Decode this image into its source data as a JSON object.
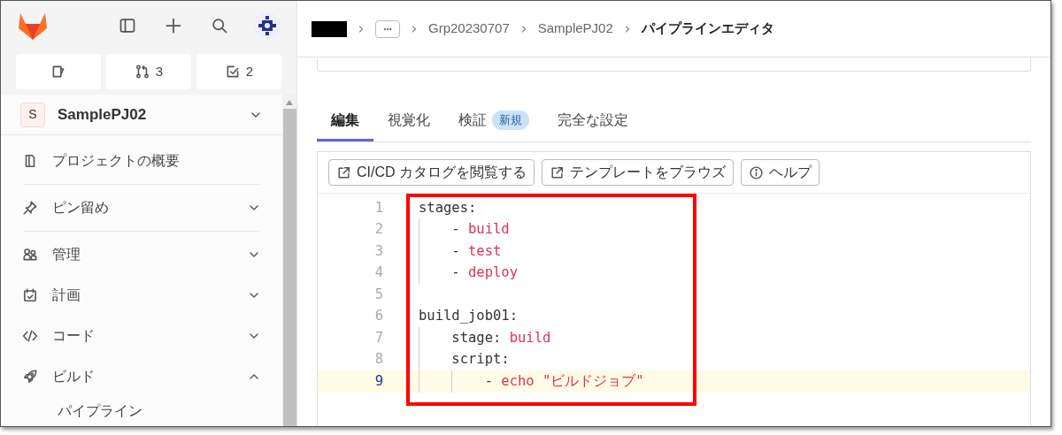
{
  "sidebar": {
    "counters": [
      {
        "kind": "issues"
      },
      {
        "kind": "merge",
        "count": "3"
      },
      {
        "kind": "todo",
        "count": "2"
      }
    ],
    "project": {
      "avatar": "S",
      "name": "SamplePJ02"
    },
    "items": [
      {
        "label": "プロジェクトの概要"
      },
      {
        "label": "ピン留め",
        "expanded": false
      },
      {
        "label": "管理",
        "expanded": false
      },
      {
        "label": "計画",
        "expanded": false
      },
      {
        "label": "コード",
        "expanded": false
      },
      {
        "label": "ビルド",
        "expanded": true,
        "children": [
          {
            "label": "パイプライン"
          }
        ]
      }
    ]
  },
  "breadcrumb": [
    {
      "kind": "redacted"
    },
    {
      "kind": "more"
    },
    {
      "kind": "link",
      "label": "Grp20230707"
    },
    {
      "kind": "link",
      "label": "SamplePJ02"
    },
    {
      "kind": "current",
      "label": "パイプラインエディタ"
    }
  ],
  "tabs": [
    {
      "label": "編集",
      "selected": true
    },
    {
      "label": "視覚化",
      "selected": false
    },
    {
      "label": "検証",
      "selected": false,
      "badge": "新規"
    },
    {
      "label": "完全な設定",
      "selected": false
    }
  ],
  "toolbar": [
    {
      "label": "CI/CD カタログを閲覧する",
      "kind": "external"
    },
    {
      "label": "テンプレートをブラウズ",
      "kind": "external"
    },
    {
      "label": "ヘルプ",
      "kind": "help"
    }
  ],
  "editor": {
    "lines": [
      {
        "number": "1",
        "active": false,
        "tokens": [
          {
            "kind": "key",
            "text": "stages:"
          }
        ]
      },
      {
        "number": "2",
        "active": false,
        "tokens": [
          {
            "kind": "plain",
            "text": "    - "
          },
          {
            "kind": "value",
            "text": "build"
          }
        ]
      },
      {
        "number": "3",
        "active": false,
        "tokens": [
          {
            "kind": "plain",
            "text": "    - "
          },
          {
            "kind": "value",
            "text": "test"
          }
        ]
      },
      {
        "number": "4",
        "active": false,
        "tokens": [
          {
            "kind": "plain",
            "text": "    - "
          },
          {
            "kind": "value",
            "text": "deploy"
          }
        ]
      },
      {
        "number": "5",
        "active": false
      },
      {
        "number": "6",
        "active": false,
        "tokens": [
          {
            "kind": "key",
            "text": "build_job01:"
          }
        ]
      },
      {
        "number": "7",
        "active": false,
        "tokens": [
          {
            "kind": "plain",
            "text": "    stage: "
          },
          {
            "kind": "value",
            "text": "build"
          }
        ]
      },
      {
        "number": "8",
        "active": false,
        "tokens": [
          {
            "kind": "plain",
            "text": "    script:"
          }
        ]
      },
      {
        "number": "9",
        "active": true,
        "tokens": [
          {
            "kind": "plain",
            "text": "        - "
          },
          {
            "kind": "value",
            "text": "echo \"ビルドジョブ\""
          }
        ]
      }
    ]
  }
}
